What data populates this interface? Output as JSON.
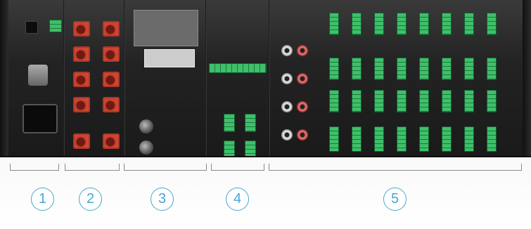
{
  "callouts": [
    {
      "number": "1"
    },
    {
      "number": "2"
    },
    {
      "number": "3"
    },
    {
      "number": "4"
    },
    {
      "number": "5"
    }
  ],
  "colors": {
    "callout_blue": "#4aa6d0",
    "chassis": "#232323",
    "terminal_green": "#3fbf6a",
    "port_red": "#d9503c"
  }
}
